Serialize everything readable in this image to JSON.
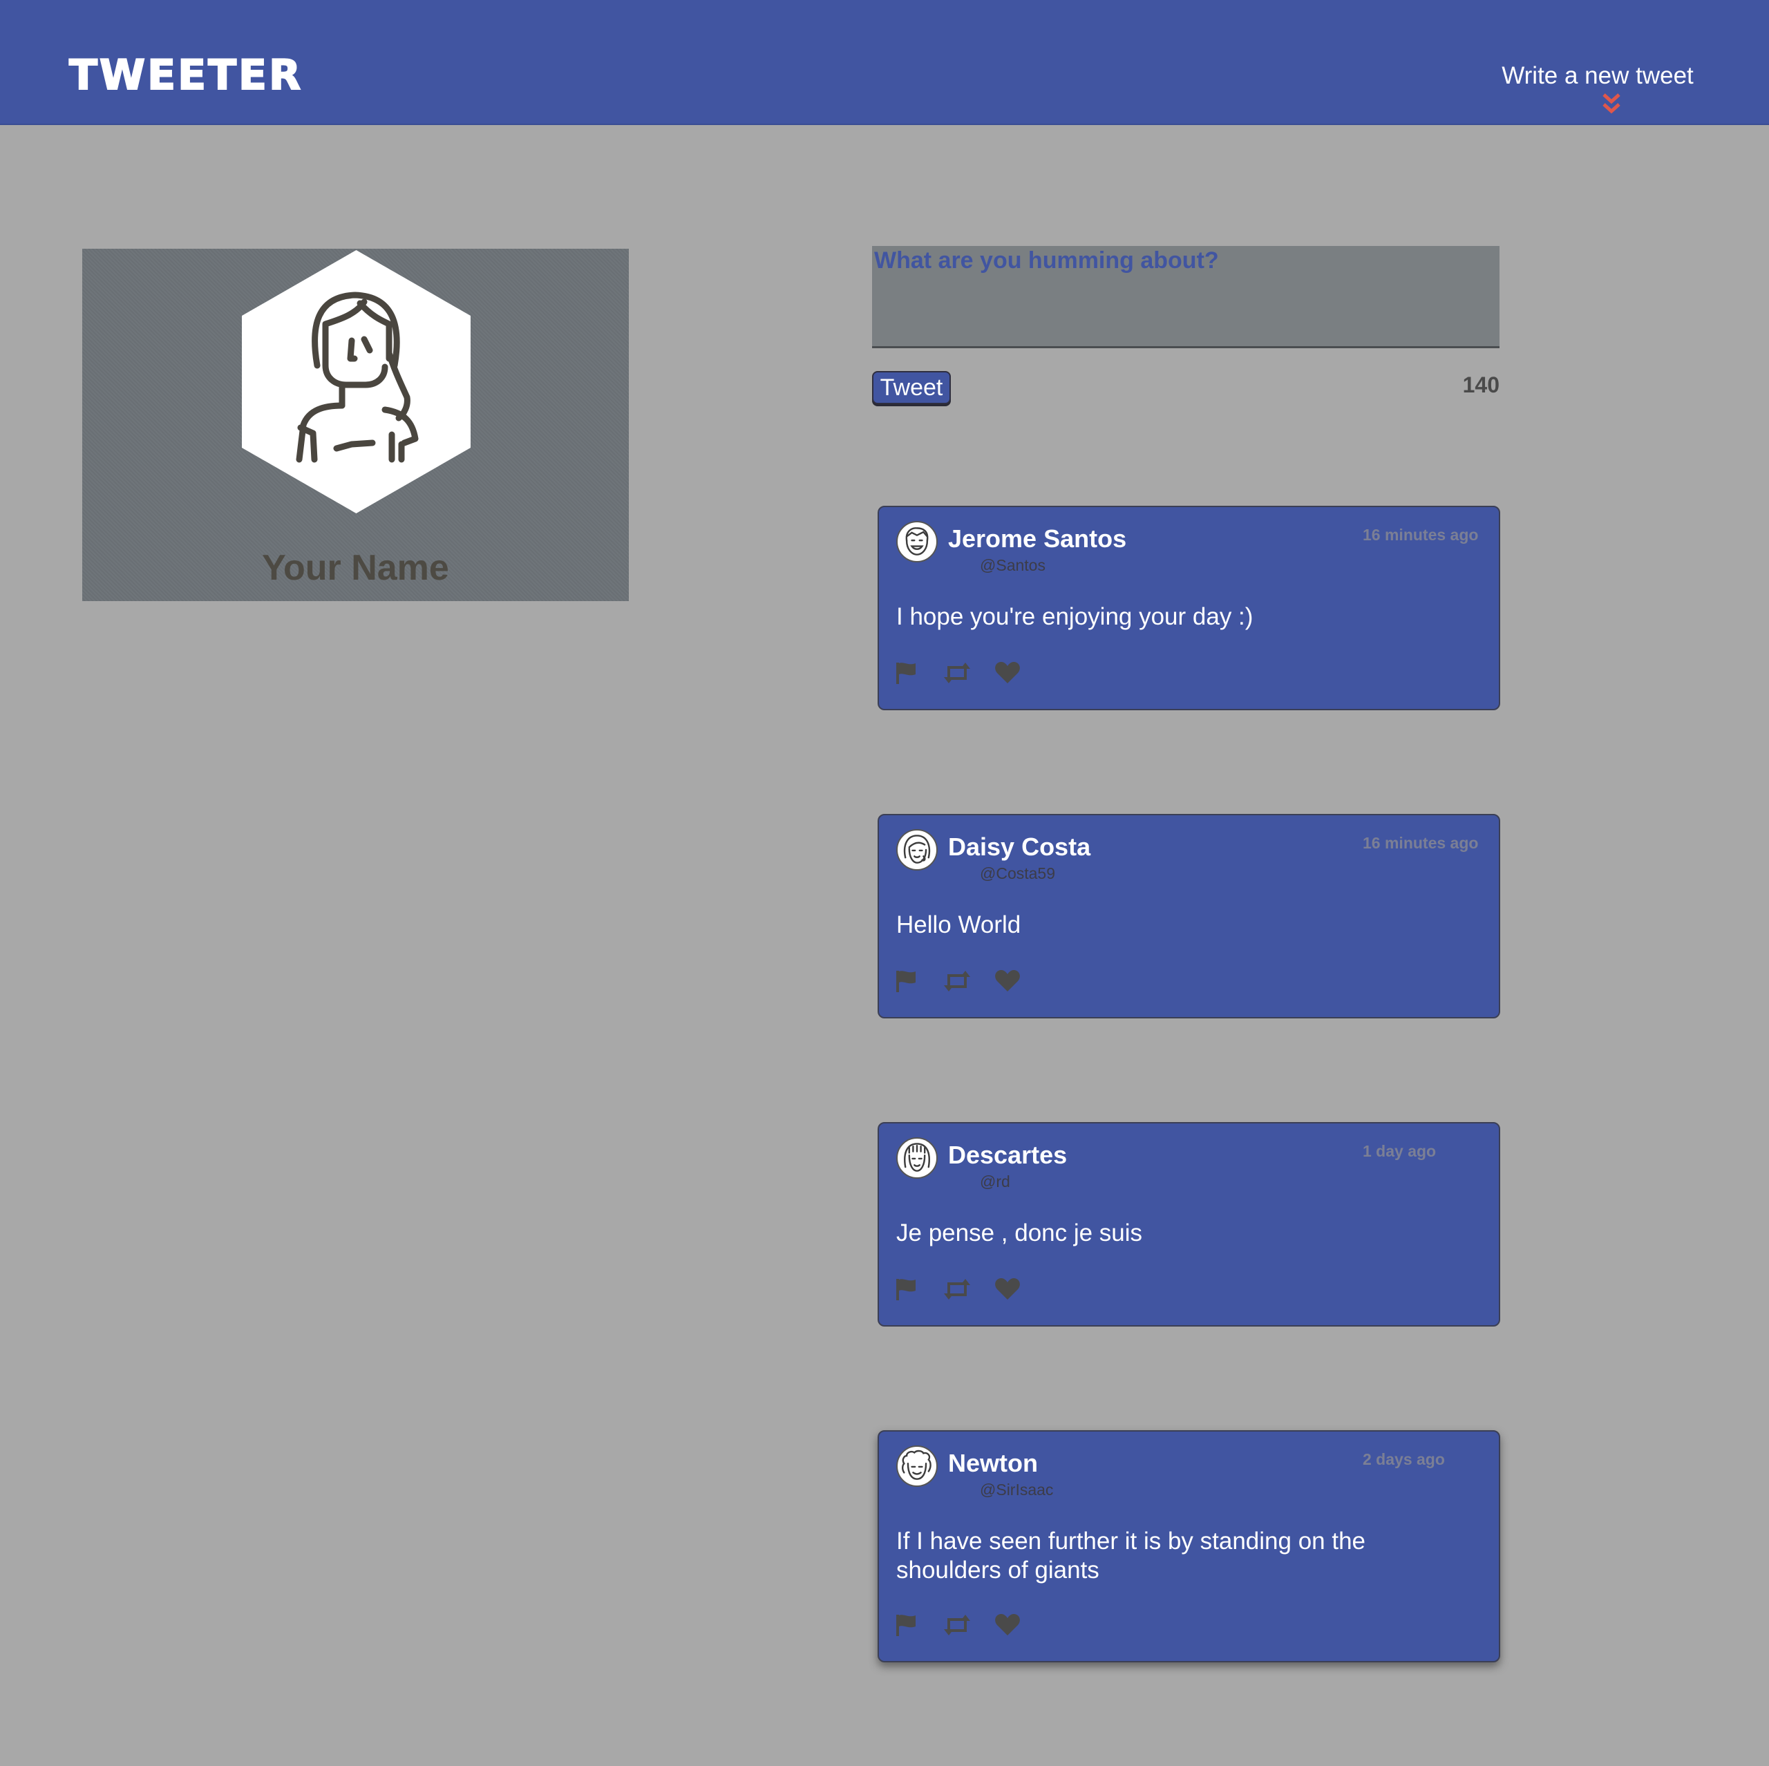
{
  "app": {
    "logo": "TWEETER",
    "nav_link": "Write a new tweet"
  },
  "profile": {
    "name": "Your Name",
    "avatar_icon": "woman-avatar-icon"
  },
  "composer": {
    "placeholder": "What are you humming about?",
    "value": "",
    "button_label": "Tweet",
    "char_count": "140"
  },
  "tweets": [
    {
      "name": "Jerome Santos",
      "handle": "@Santos",
      "time": "16 minutes ago",
      "content": "I hope you're enjoying your day :)"
    },
    {
      "name": "Daisy Costa",
      "handle": "@Costa59",
      "time": "16 minutes ago",
      "content": "Hello World"
    },
    {
      "name": "Descartes",
      "handle": "@rd",
      "time": "1 day ago",
      "content": "Je pense , donc je suis"
    },
    {
      "name": "Newton",
      "handle": "@SirIsaac",
      "time": "2 days ago",
      "content": "If I have seen further it is by standing on the shoulders of giants"
    }
  ],
  "colors": {
    "primary": "#4155a1",
    "background": "#a8a8a8",
    "accent": "#e0574b",
    "icon": "#4a4a4a"
  }
}
